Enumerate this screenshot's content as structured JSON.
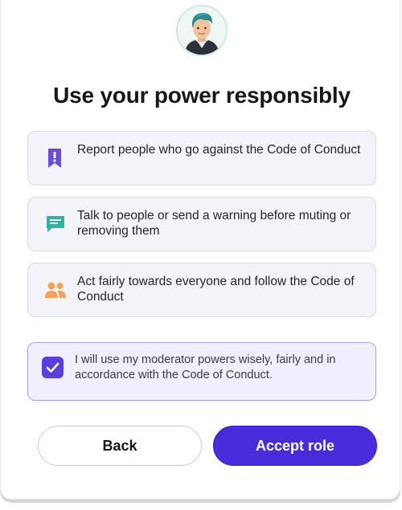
{
  "dialog": {
    "title": "Use your power responsibly",
    "avatar_icon": "user-avatar-icon",
    "rules": [
      {
        "icon": "report-flag-icon",
        "icon_color": "#6a4cdc",
        "text": "Report people who go against the Code of Conduct"
      },
      {
        "icon": "chat-message-icon",
        "icon_color": "#2bb5a0",
        "text": "Talk to people or send a warning before muting or removing them"
      },
      {
        "icon": "people-icon",
        "icon_color": "#f3a25a",
        "text": "Act fairly towards everyone and follow the Code of Conduct"
      }
    ],
    "agreement": {
      "checked": true,
      "text": "I will use my moderator powers wisely, fairly and in accordance with the Code of Conduct."
    },
    "buttons": {
      "back_label": "Back",
      "accept_label": "Accept role"
    }
  },
  "colors": {
    "accent": "#4a2bd9",
    "agree_bg": "#f1eefd",
    "agree_border": "#a99de6",
    "item_bg": "#f2f4f9"
  }
}
